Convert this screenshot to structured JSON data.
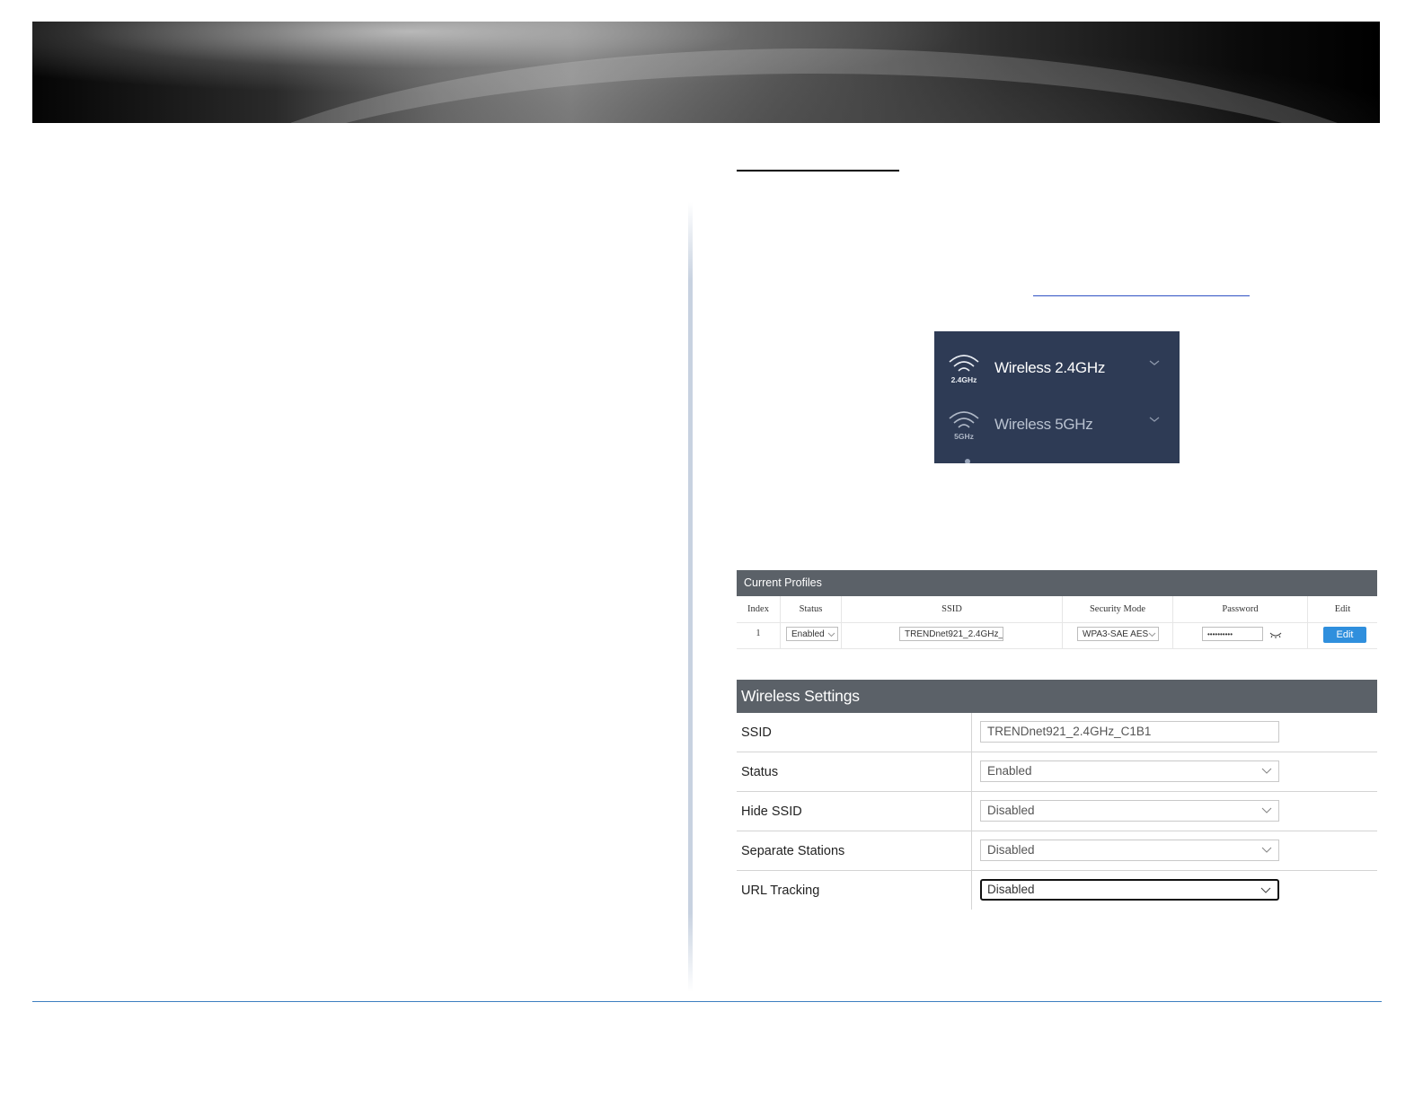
{
  "wireless_menu": {
    "items": [
      {
        "label": "Wireless 2.4GHz",
        "badge": "2.4GHz",
        "icon": "wifi-icon"
      },
      {
        "label": "Wireless 5GHz",
        "badge": "5GHz",
        "icon": "wifi-icon"
      }
    ]
  },
  "current_profiles": {
    "title": "Current Profiles",
    "headers": [
      "Index",
      "Status",
      "SSID",
      "Security Mode",
      "Password",
      "Edit"
    ],
    "row": {
      "index": "1",
      "status": "Enabled",
      "ssid": "TRENDnet921_2.4GHz_",
      "security_mode": "WPA3-SAE AES",
      "password": "••••••••••",
      "edit_label": "Edit"
    }
  },
  "wireless_settings": {
    "title": "Wireless Settings",
    "rows": [
      {
        "label": "SSID",
        "value": "TRENDnet921_2.4GHz_C1B1"
      },
      {
        "label": "Status",
        "value": "Enabled"
      },
      {
        "label": "Hide SSID",
        "value": "Disabled"
      },
      {
        "label": "Separate Stations",
        "value": "Disabled"
      },
      {
        "label": "URL Tracking",
        "value": "Disabled"
      }
    ]
  },
  "colors": {
    "menu_bg": "#2e3b55",
    "header_bg": "#5b6168",
    "edit_button": "#2f8fdd",
    "footer_rule": "#3d7fc0"
  }
}
